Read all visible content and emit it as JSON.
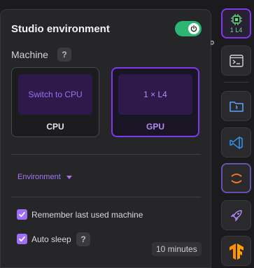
{
  "settings": {
    "title": "Studio environment",
    "toggle_on": true,
    "machine_label": "Machine",
    "help_glyph": "?",
    "cards": {
      "cpu": {
        "preview_text": "Switch to CPU",
        "label": "CPU",
        "selected": false
      },
      "gpu": {
        "preview_text": "1 × L4",
        "label": "GPU",
        "selected": true
      }
    },
    "environment_label": "Environment",
    "remember_label": "Remember last used machine",
    "remember_checked": true,
    "autosleep_label": "Auto sleep",
    "autosleep_checked": true,
    "autosleep_value": "10 minutes"
  },
  "sidebar": {
    "gpu_chip_label": "1 L4",
    "items": [
      {
        "name": "gpu-chip-icon",
        "active": true
      },
      {
        "name": "terminal-icon"
      },
      {
        "name": "folder-icon"
      },
      {
        "name": "vscode-icon"
      },
      {
        "name": "jupyter-icon"
      },
      {
        "name": "rocket-icon"
      },
      {
        "name": "tensorflow-icon"
      }
    ]
  },
  "colors": {
    "accent_purple": "#7c3aed",
    "toggle_green": "#2bb673",
    "checkbox_purple": "#a06ef5"
  }
}
